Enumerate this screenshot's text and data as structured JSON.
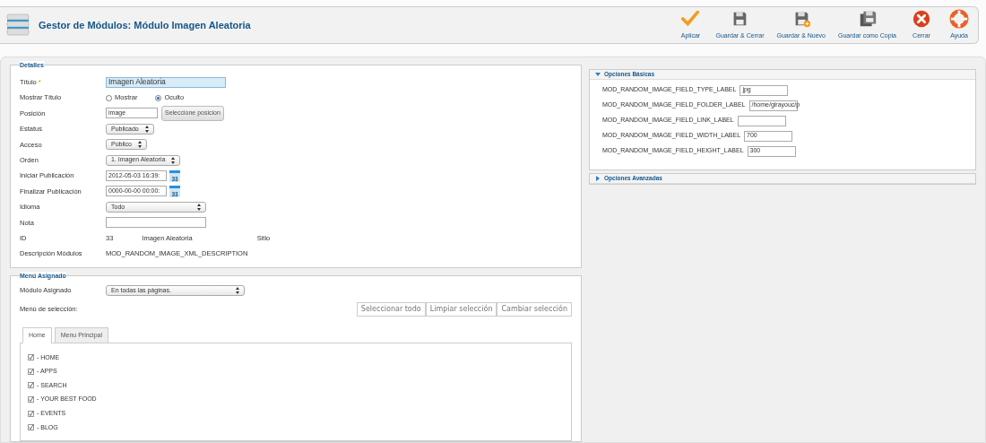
{
  "header": {
    "title": "Gestor de Módulos: Módulo Imagen Aleatoria"
  },
  "toolbar": [
    {
      "kind": "apply",
      "label": "Aplicar"
    },
    {
      "kind": "save",
      "label": "Guardar & Cerrar"
    },
    {
      "kind": "save_new",
      "label": "Guardar & Nuevo"
    },
    {
      "kind": "save_copy",
      "label": "Guardar como Copia"
    },
    {
      "kind": "close",
      "label": "Cerrar"
    },
    {
      "kind": "help",
      "label": "Ayuda"
    }
  ],
  "details": {
    "legend": "Detalles",
    "fields": [
      {
        "kind": "text",
        "label": "Título",
        "marker": "*",
        "value": "Imagen Aleatoria",
        "highlighted": true
      },
      {
        "kind": "radio",
        "label": "Mostrar Título",
        "options": [
          {
            "label": "Mostrar",
            "selected": false
          },
          {
            "label": "Oculto",
            "selected": true
          }
        ]
      },
      {
        "kind": "text_button",
        "label": "Posición",
        "value": "image",
        "button": "Seleccione posicion"
      },
      {
        "kind": "select",
        "label": "Estatus",
        "value": "Publicado",
        "wide": false
      },
      {
        "kind": "select",
        "label": "Acceso",
        "value": "Público",
        "wide": false
      },
      {
        "kind": "select",
        "label": "Orden",
        "value": "1. Imagen Aleatoria",
        "wide": false
      },
      {
        "kind": "date",
        "label": "Iniciar Publicación",
        "value": "2012-05-03 16:39:",
        "calendar": "33"
      },
      {
        "kind": "date",
        "label": "Finalizar Publicación",
        "value": "0000-00-00 00:00:",
        "calendar": "33"
      },
      {
        "kind": "select",
        "label": "Idioma",
        "value": "Todo",
        "wide": true
      },
      {
        "kind": "text",
        "label": "Nota",
        "highlighted": false
      },
      {
        "kind": "static",
        "label": "ID",
        "values": [
          "33",
          "Imagen Aleatoria",
          "Sitio"
        ]
      },
      {
        "kind": "static",
        "label": "Descripción Módulos",
        "values": [
          "MOD_RANDOM_IMAGE_XML_DESCRIPTION"
        ]
      }
    ]
  },
  "menu": {
    "legend": "Menú Asignado",
    "assigned_label": "Módulo Asignado",
    "assigned_value": "En todas las páginas.",
    "selection_label": "Menú de selección:",
    "buttons": [
      "Seleccionar todo",
      "Limpiar selección",
      "Cambiar selección"
    ],
    "tabs": [
      {
        "label": "Home",
        "selected": true
      },
      {
        "label": "Menu Principal",
        "selected": false
      }
    ],
    "items": [
      {
        "label": "- HOME",
        "checked": true
      },
      {
        "label": "- APPS",
        "checked": true
      },
      {
        "label": "- SEARCH",
        "checked": true
      },
      {
        "label": "- YOUR BEST FOOD",
        "checked": true
      },
      {
        "label": "- EVENTS",
        "checked": true
      },
      {
        "label": "- BLOG",
        "checked": true
      }
    ]
  },
  "options": [
    {
      "title": "Opciones Básicas",
      "expanded": true,
      "fields": [
        {
          "label": "MOD_RANDOM_IMAGE_FIELD_TYPE_LABEL",
          "value": "jpg"
        },
        {
          "label": "MOD_RANDOM_IMAGE_FIELD_FOLDER_LABEL",
          "value": "/home/girayouc/p"
        },
        {
          "label": "MOD_RANDOM_IMAGE_FIELD_LINK_LABEL"
        },
        {
          "label": "MOD_RANDOM_IMAGE_FIELD_WIDTH_LABEL",
          "value": "700"
        },
        {
          "label": "MOD_RANDOM_IMAGE_FIELD_HEIGHT_LABEL",
          "value": "300"
        }
      ]
    },
    {
      "title": "Opciones Avanzadas",
      "expanded": false
    }
  ]
}
